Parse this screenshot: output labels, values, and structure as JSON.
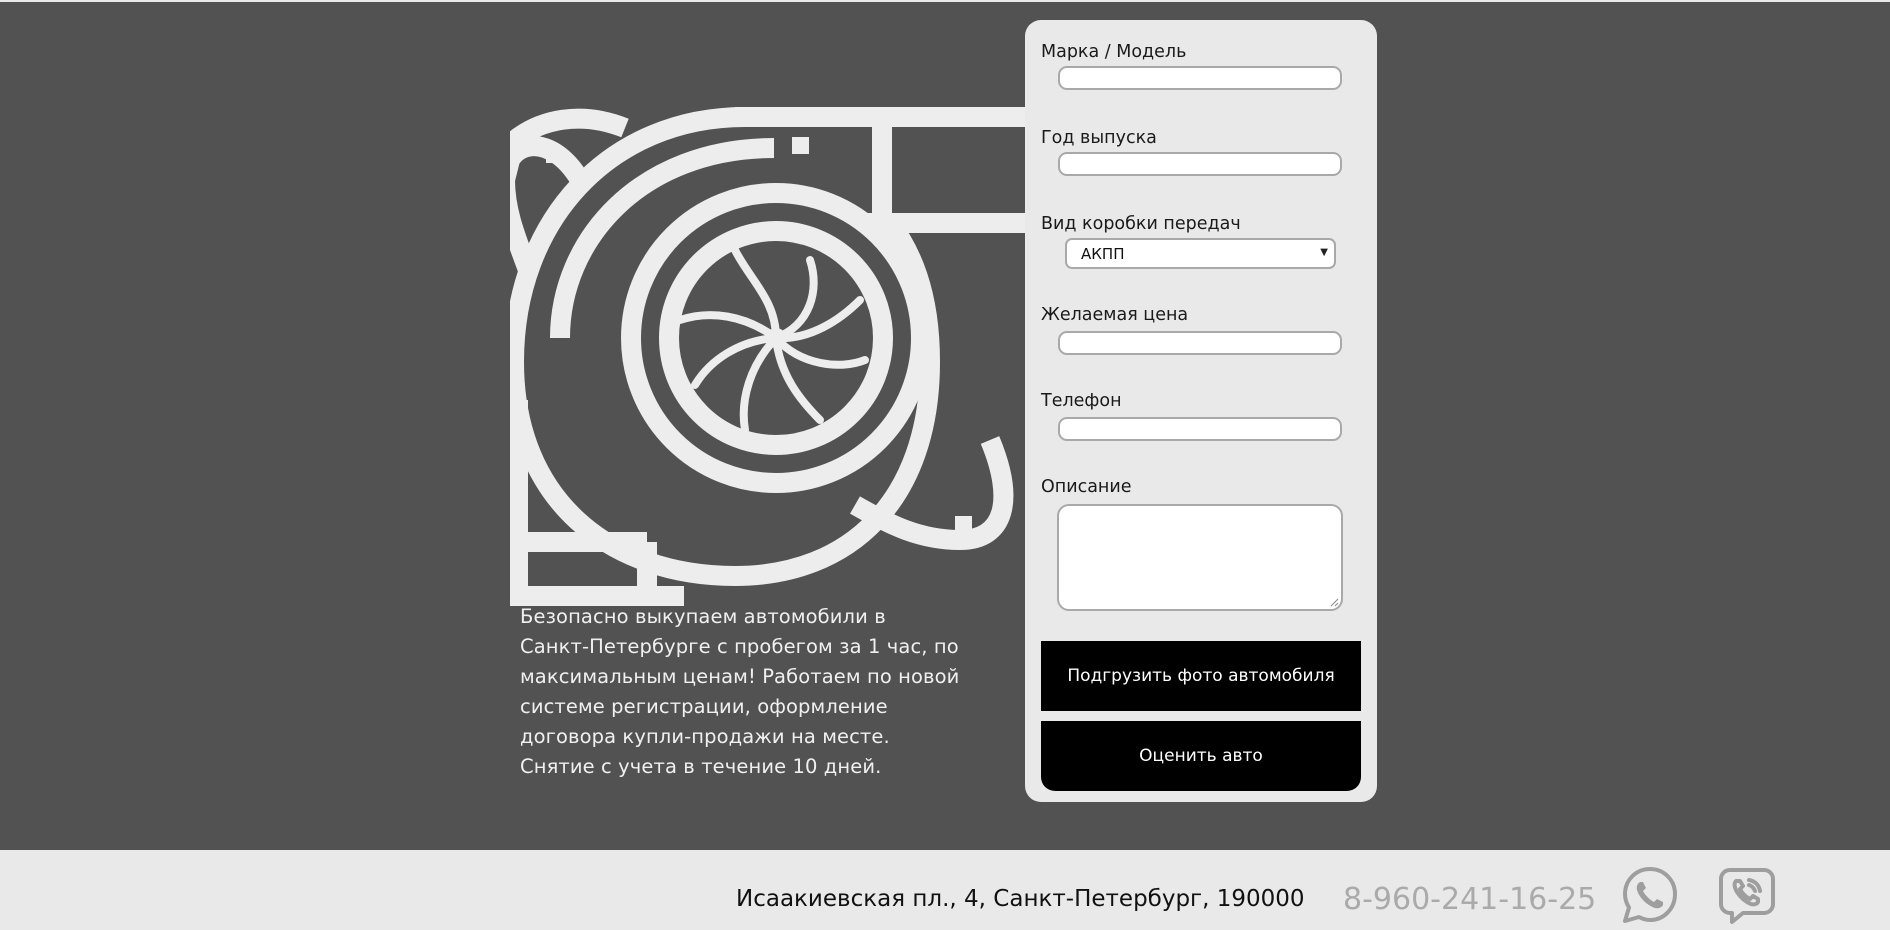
{
  "form": {
    "make_model_label": "Марка / Модель",
    "make_model_value": "",
    "year_label": "Год выпуска",
    "year_value": "",
    "gearbox_label": "Вид коробки передач",
    "gearbox_value": "АКПП",
    "price_label": "Желаемая цена",
    "price_value": "",
    "phone_label": "Телефон",
    "phone_value": "",
    "description_label": "Описание",
    "description_value": "",
    "upload_button": "Подгрузить фото автомобиля",
    "submit_button": "Оценить авто"
  },
  "hero": {
    "icon": "turbocharger-icon",
    "text": "Безопасно выкупаем автомобили в Санкт-Петербурге с пробегом за 1 час, по максимальным ценам! Работаем по новой системе регистрации, оформление договора купли-продажи на месте. Снятие с учета в течение 10 дней."
  },
  "footer": {
    "address": "Исаакиевская пл., 4, Санкт-Петербург, 190000",
    "phone": "8-960-241-16-25",
    "icons": [
      "whatsapp-icon",
      "viber-icon"
    ]
  },
  "colors": {
    "hero_bg": "#525252",
    "card_bg": "#e9e9e9",
    "button_bg": "#000000",
    "phone_text": "#aaaaaa"
  }
}
